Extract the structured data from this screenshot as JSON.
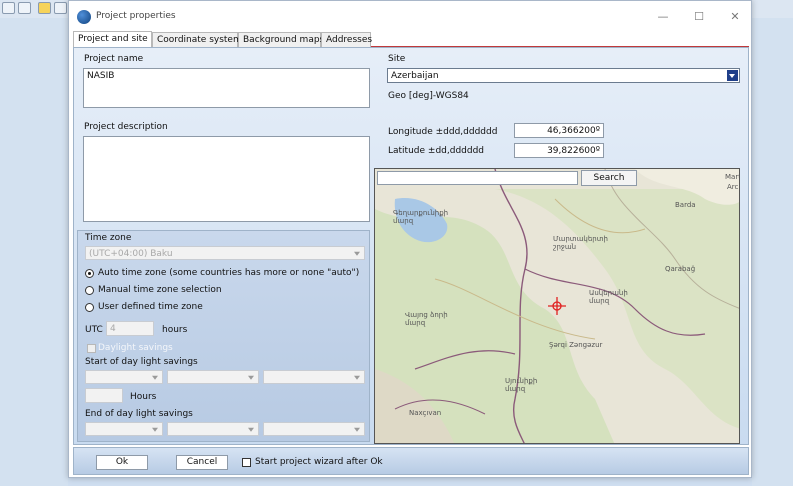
{
  "window": {
    "title": "Project properties",
    "minimize": "—",
    "maximize": "☐",
    "close": "✕"
  },
  "tabs": [
    {
      "label": "Project and site"
    },
    {
      "label": "Coordinate system"
    },
    {
      "label": "Background maps"
    },
    {
      "label": "Addresses"
    }
  ],
  "project": {
    "name_label": "Project name",
    "name_value": "NASIB",
    "description_label": "Project description",
    "description_value": ""
  },
  "timezone": {
    "label": "Time zone",
    "value": "(UTC+04:00) Baku",
    "options": [
      {
        "label": "Auto time zone  (some countries has more or none \"auto\")",
        "selected": true
      },
      {
        "label": "Manual time zone selection",
        "selected": false
      },
      {
        "label": "User defined time zone",
        "selected": false
      }
    ],
    "utc_label": "UTC",
    "utc_value": "4",
    "hours_label": "hours",
    "daylight_label": "Daylight savings",
    "start_label": "Start of day light savings",
    "hours2_label": "Hours",
    "end_label": "End of day light savings"
  },
  "site": {
    "label": "Site",
    "value": "Azerbaijan",
    "crs": "Geo [deg]-WGS84",
    "longitude_label": "Longitude ±ddd,dddddd",
    "longitude_value": "46,366200º",
    "latitude_label": "Latitude ±dd,dddddd",
    "latitude_value": "39,822600º"
  },
  "map": {
    "search_placeholder": "",
    "search_button": "Search",
    "labels": {
      "sevan": "Գեղարքունիքի\nմարզ",
      "barda": "Barda",
      "martakert": "Մարտակերտի\nշրջան",
      "qarabag": "Qarabağ",
      "askeran": "Ասկերանի\nմարզ",
      "vayots": "Վայոց ձորի\nմարզ",
      "zangazur": "Şərqi Zəngəzur",
      "syunik": "Սյունիքի\nմարզ",
      "naxcivan": "Naxçıvan",
      "mart": "Mart",
      "arc": "Arc"
    }
  },
  "footer": {
    "ok": "Ok",
    "cancel": "Cancel",
    "wizard_label": "Start project wizard after Ok"
  },
  "colors": {
    "accent": "#1f3f8a",
    "border_red": "#c0393b",
    "map_border": "#8b5a7a",
    "marker": "#e02020"
  }
}
